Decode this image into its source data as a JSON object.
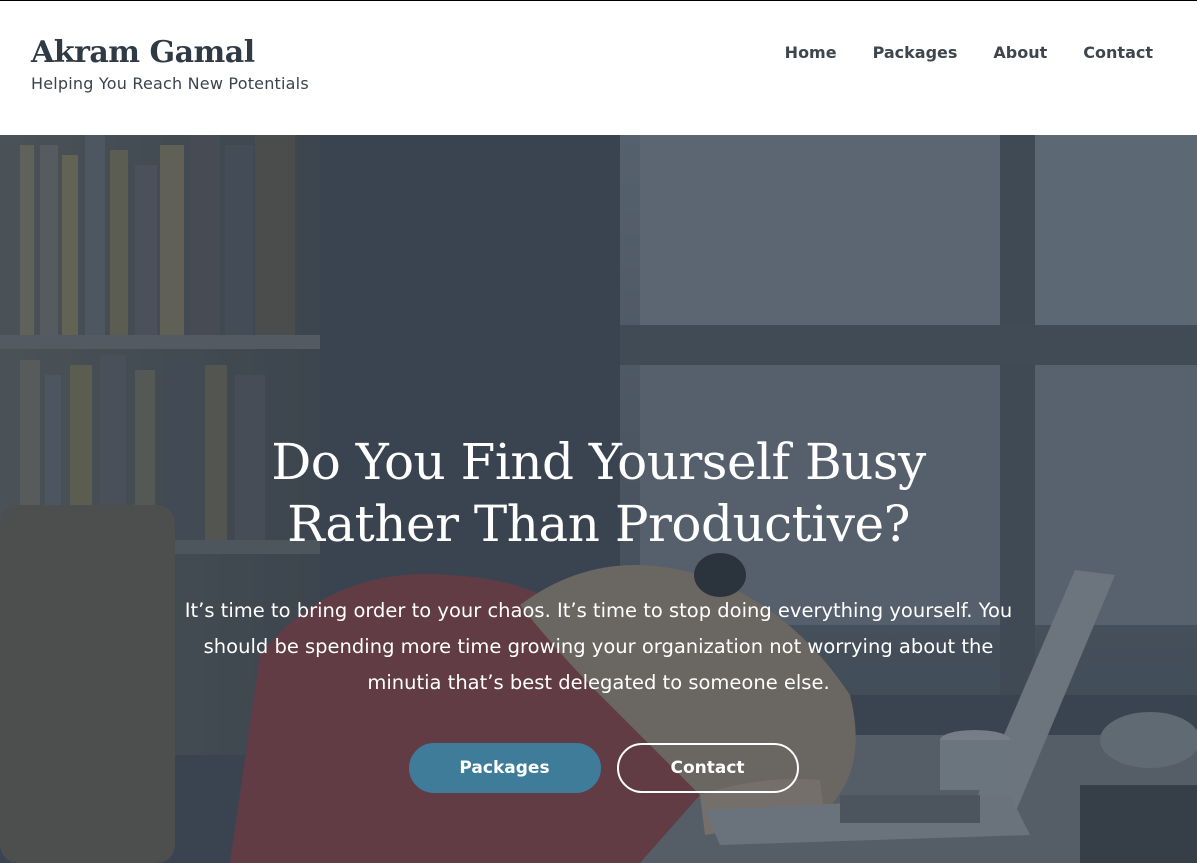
{
  "site": {
    "title": "Akram Gamal",
    "tagline": "Helping You Reach New Potentials"
  },
  "nav": {
    "items": [
      {
        "label": "Home"
      },
      {
        "label": "Packages"
      },
      {
        "label": "About"
      },
      {
        "label": "Contact"
      }
    ]
  },
  "hero": {
    "heading": "Do You Find Yourself Busy Rather Than Productive?",
    "body": "It’s time to bring order to your chaos. It’s time to stop doing everything yourself. You should be spending more time growing your organization not worrying about the minutia that’s best delegated to someone else.",
    "primary_button": "Packages",
    "secondary_button": "Contact",
    "background_image": "tired-woman-asleep-on-desk-with-laptop-photo"
  },
  "colors": {
    "title": "#2f3a44",
    "nav_text": "#3d454d",
    "accent": "#3f7c99",
    "overlay": "#3c4752",
    "hero_text": "#ffffff"
  }
}
